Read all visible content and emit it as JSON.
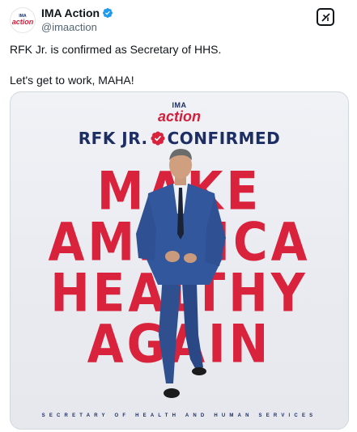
{
  "account": {
    "display_name": "IMA Action",
    "handle": "@imaaction",
    "avatar_top": "IMA",
    "avatar_bottom": "action"
  },
  "tweet": {
    "lines": [
      "RFK Jr. is confirmed as Secretary of HHS.",
      "Let's get to work, MAHA!"
    ]
  },
  "grok_icon": "grok-icon",
  "media": {
    "logo_top": "IMA",
    "logo_bottom": "action",
    "headline_left": "RFK JR.",
    "headline_right": "CONFIRMED",
    "words": [
      "MAKE",
      "AMERICA",
      "HEALTHY",
      "AGAIN"
    ],
    "footer": "SECRETARY OF HEALTH AND HUMAN SERVICES"
  },
  "colors": {
    "verified": "#1d9bf0",
    "brand_red": "#d9223b",
    "navy": "#1c2e63"
  }
}
